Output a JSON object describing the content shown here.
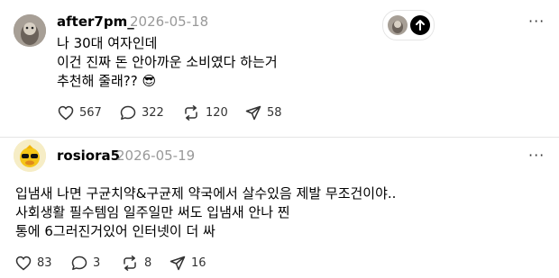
{
  "post": {
    "username": "after7pm_",
    "date": "2026-05-18",
    "lines": [
      "나 30대 여자인데",
      "이건 진짜 돈 안아까운 소비였다 하는거",
      "추천해 줄래??"
    ],
    "emoji": "😎",
    "likes": "567",
    "comments": "322",
    "reposts": "120",
    "shares": "58"
  },
  "reply": {
    "username": "rosiora5",
    "date": "2026-05-19",
    "lines": [
      "입냄새 나면 구균치약&구균제 약국에서 살수있음 제발 무조건이야..",
      "사회생활 필수템임 일주일만 써도 입냄새 안나 찐",
      "통에 6그러진거있어 인터넷이 더 싸"
    ],
    "likes": "83",
    "comments": "3",
    "reposts": "8",
    "shares": "16"
  },
  "colors": {
    "date": "#999999",
    "divider": "#e5e5e5",
    "icon": "#333333"
  }
}
